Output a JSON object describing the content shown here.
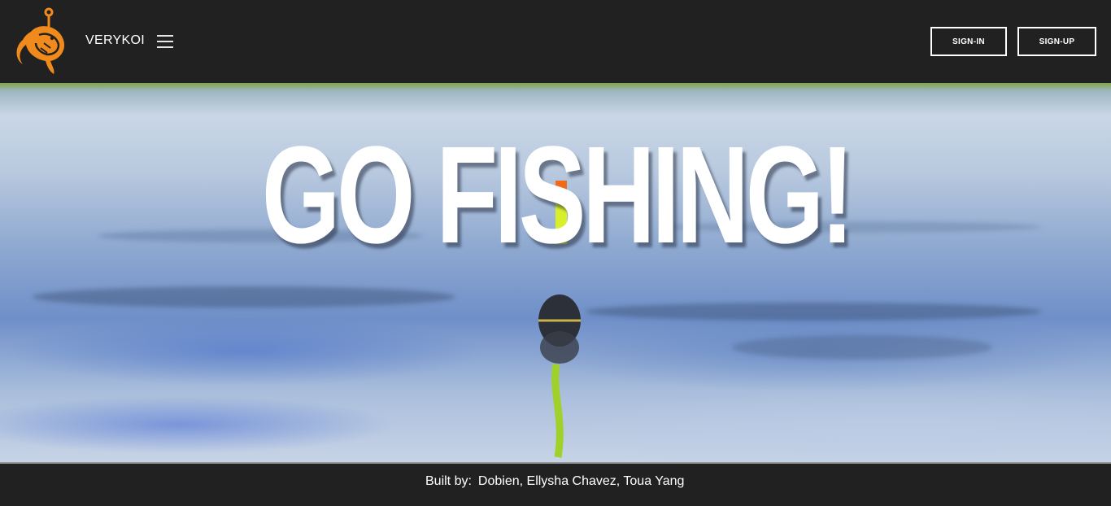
{
  "header": {
    "brand": "VERYKOI",
    "logo_icon": "koi-fish-hook-logo",
    "menu_icon": "hamburger-menu-icon",
    "signin_label": "SIGN-IN",
    "signup_label": "SIGN-UP"
  },
  "hero": {
    "headline": "GO FISHING!"
  },
  "footer": {
    "built_by_label": "Built by:",
    "names": "Dobien, Ellysha Chavez, Toua Yang"
  },
  "colors": {
    "background": "#212121",
    "accent": "#f08a1c",
    "text": "#ffffff"
  }
}
